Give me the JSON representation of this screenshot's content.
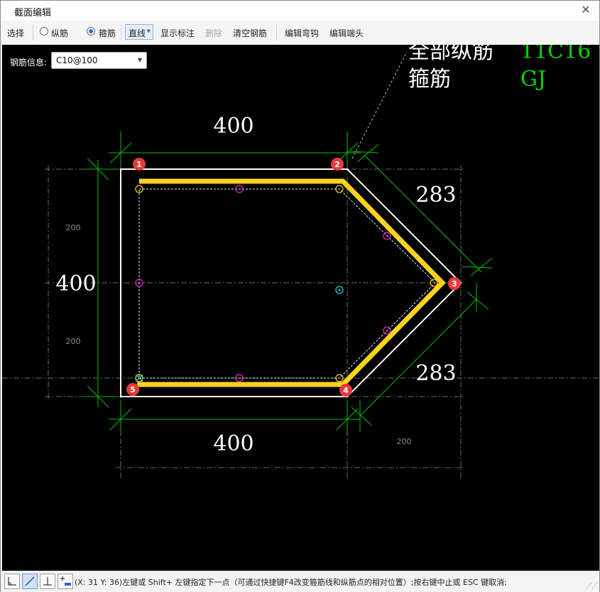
{
  "window": {
    "title": "截面编辑",
    "close_glyph": "✕"
  },
  "toolbar": {
    "select": "选择",
    "longitudinal": "纵筋",
    "stirrup": "箍筋",
    "line_mode": "直线",
    "show_dims": "显示标注",
    "delete": "删除",
    "clear_rebar": "清空钢筋",
    "edit_hook": "编辑弯钩",
    "edit_end": "编辑端头",
    "selected_radio": "stirrup"
  },
  "rebar_info": {
    "label": "钢筋信息:",
    "value": "C10@100"
  },
  "legend": {
    "row1_label": "全部纵筋",
    "row1_value": "11C16",
    "row2_label": "箍筋",
    "row2_value": "GJ",
    "value_color": "#00d600",
    "label_color": "#ffffff"
  },
  "dimensions": {
    "top": "400",
    "left": "400",
    "bottom": "400",
    "upper_slope": "283",
    "lower_slope": "283",
    "small_left_upper": "200",
    "small_left_lower": "200",
    "small_bottom_right": "200"
  },
  "markers": [
    "1",
    "2",
    "3",
    "4",
    "5"
  ],
  "colors": {
    "canvas": "#000000",
    "outline": "#ffffff",
    "stirrup": "#ffd21f",
    "dim_lines": "#00c000",
    "marker": "#e83a3a",
    "point_magenta": "#e020e0",
    "point_cyan": "#28c8d8",
    "point_yellow": "#f0d000"
  },
  "status": {
    "text": "(X: 31 Y: 36)左键或 Shift+ 左键指定下一点（可通过快捷键F4改变箍筋线和纵筋点的相对位置）;按右键中止或 ESC 键取消;"
  },
  "icons": [
    "orthogonal-mode-icon",
    "line-mode-icon",
    "perpendicular-mode-icon",
    "add-point-icon",
    "resize-grip-icon"
  ]
}
